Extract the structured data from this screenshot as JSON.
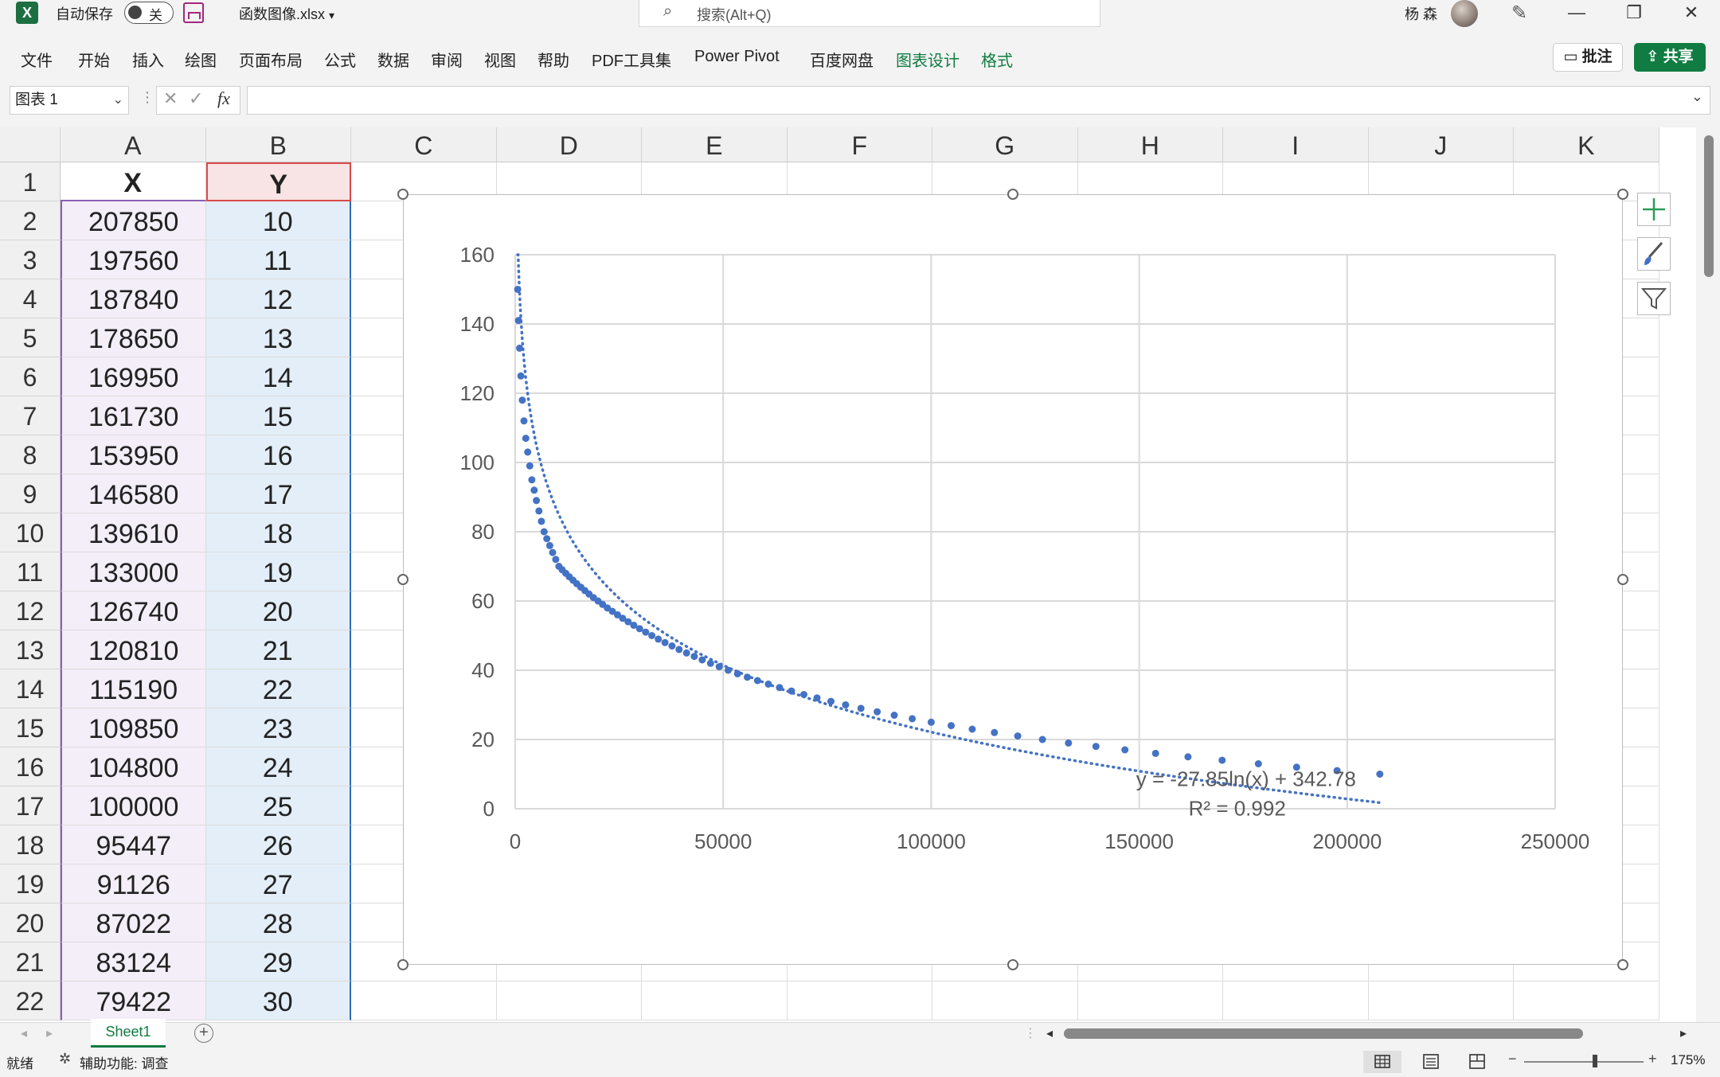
{
  "titlebar": {
    "app_logo": "X",
    "autosave_label": "自动保存",
    "autosave_state": "关",
    "filename": "函数图像.xlsx",
    "filename_caret": "▾",
    "search_placeholder": "搜索(Alt+Q)",
    "user_name": "杨 森",
    "minimize": "—",
    "restore": "❐",
    "close": "✕"
  },
  "menu": {
    "items": [
      "文件",
      "开始",
      "插入",
      "绘图",
      "页面布局",
      "公式",
      "数据",
      "审阅",
      "视图",
      "帮助",
      "PDF工具集",
      "Power Pivot",
      "百度网盘",
      "图表设计",
      "格式"
    ],
    "comment_label": "批注",
    "share_label": "共享"
  },
  "formula_bar": {
    "name_box": "图表 1",
    "cancel_glyph": "✕",
    "enter_glyph": "✓",
    "fx_label": "fx",
    "formula_value": ""
  },
  "sheet": {
    "columns": [
      "A",
      "B",
      "C",
      "D",
      "E",
      "F",
      "G",
      "H",
      "I",
      "J",
      "K"
    ],
    "rows": [
      "1",
      "2",
      "3",
      "4",
      "5",
      "6",
      "7",
      "8",
      "9",
      "10",
      "11",
      "12",
      "13",
      "14",
      "15",
      "16",
      "17",
      "18",
      "19",
      "20",
      "21",
      "22"
    ],
    "header": [
      "X",
      "Y"
    ],
    "data": [
      [
        "207850",
        "10"
      ],
      [
        "197560",
        "11"
      ],
      [
        "187840",
        "12"
      ],
      [
        "178650",
        "13"
      ],
      [
        "169950",
        "14"
      ],
      [
        "161730",
        "15"
      ],
      [
        "153950",
        "16"
      ],
      [
        "146580",
        "17"
      ],
      [
        "139610",
        "18"
      ],
      [
        "133000",
        "19"
      ],
      [
        "126740",
        "20"
      ],
      [
        "120810",
        "21"
      ],
      [
        "115190",
        "22"
      ],
      [
        "109850",
        "23"
      ],
      [
        "104800",
        "24"
      ],
      [
        "100000",
        "25"
      ],
      [
        "95447",
        "26"
      ],
      [
        "91126",
        "27"
      ],
      [
        "87022",
        "28"
      ],
      [
        "83124",
        "29"
      ],
      [
        "79422",
        "30"
      ]
    ]
  },
  "chart_data": {
    "type": "scatter",
    "title": "",
    "xlabel": "",
    "ylabel": "",
    "xlim": [
      0,
      250000
    ],
    "ylim": [
      0,
      160
    ],
    "x_ticks": [
      "0",
      "50000",
      "100000",
      "150000",
      "200000",
      "250000"
    ],
    "y_ticks": [
      "0",
      "20",
      "40",
      "60",
      "80",
      "100",
      "120",
      "140",
      "160"
    ],
    "grid": true,
    "legend": "none",
    "series_color": "#4472c4",
    "x": [
      207850,
      197560,
      187840,
      178650,
      169950,
      161730,
      153950,
      146580,
      139610,
      133000,
      126740,
      120810,
      115190,
      109850,
      104800,
      100000,
      95447,
      91126,
      87022,
      83124,
      79422,
      75900,
      72550,
      69400,
      66400,
      63550,
      60850,
      58250,
      55800,
      53450,
      51200,
      49050,
      46950,
      44950,
      43050,
      41200,
      39400,
      37700,
      36000,
      34400,
      32850,
      31350,
      29900,
      28500,
      27150,
      25850,
      24600,
      23350,
      22150,
      21000,
      19900,
      18800,
      17750,
      16750,
      15750,
      14800,
      13900,
      13000,
      12150,
      11300,
      10500,
      9750,
      9000,
      8300,
      7600,
      6950,
      6300,
      5700,
      5100,
      4550,
      4000,
      3500,
      3000,
      2550,
      2100,
      1700,
      1350,
      1050,
      800,
      600
    ],
    "y": [
      10,
      11,
      12,
      13,
      14,
      15,
      16,
      17,
      18,
      19,
      20,
      21,
      22,
      23,
      24,
      25,
      26,
      27,
      28,
      29,
      30,
      31,
      32,
      33,
      34,
      35,
      36,
      37,
      38,
      39,
      40,
      41,
      42,
      43,
      44,
      45,
      46,
      47,
      48,
      49,
      50,
      51,
      52,
      53,
      54,
      55,
      56,
      57,
      58,
      59,
      60,
      61,
      62,
      63,
      64,
      65,
      66,
      67,
      68,
      69,
      70,
      72,
      74,
      76,
      78,
      80,
      83,
      86,
      89,
      92,
      95,
      99,
      103,
      107,
      112,
      118,
      125,
      133,
      141,
      150
    ],
    "trendline": {
      "type": "logarithmic",
      "a": -27.85,
      "b": 342.78,
      "x_range": [
        600,
        207850
      ],
      "equation_label": "y = -27.85ln(x) + 342.78",
      "r2_label": "R² = 0.992"
    }
  },
  "sheet_tabs": {
    "active": "Sheet1",
    "add_glyph": "+"
  },
  "statusbar": {
    "ready": "就绪",
    "accessibility": "辅助功能: 调查",
    "zoom": "175%",
    "zoom_minus": "−",
    "zoom_plus": "+"
  }
}
